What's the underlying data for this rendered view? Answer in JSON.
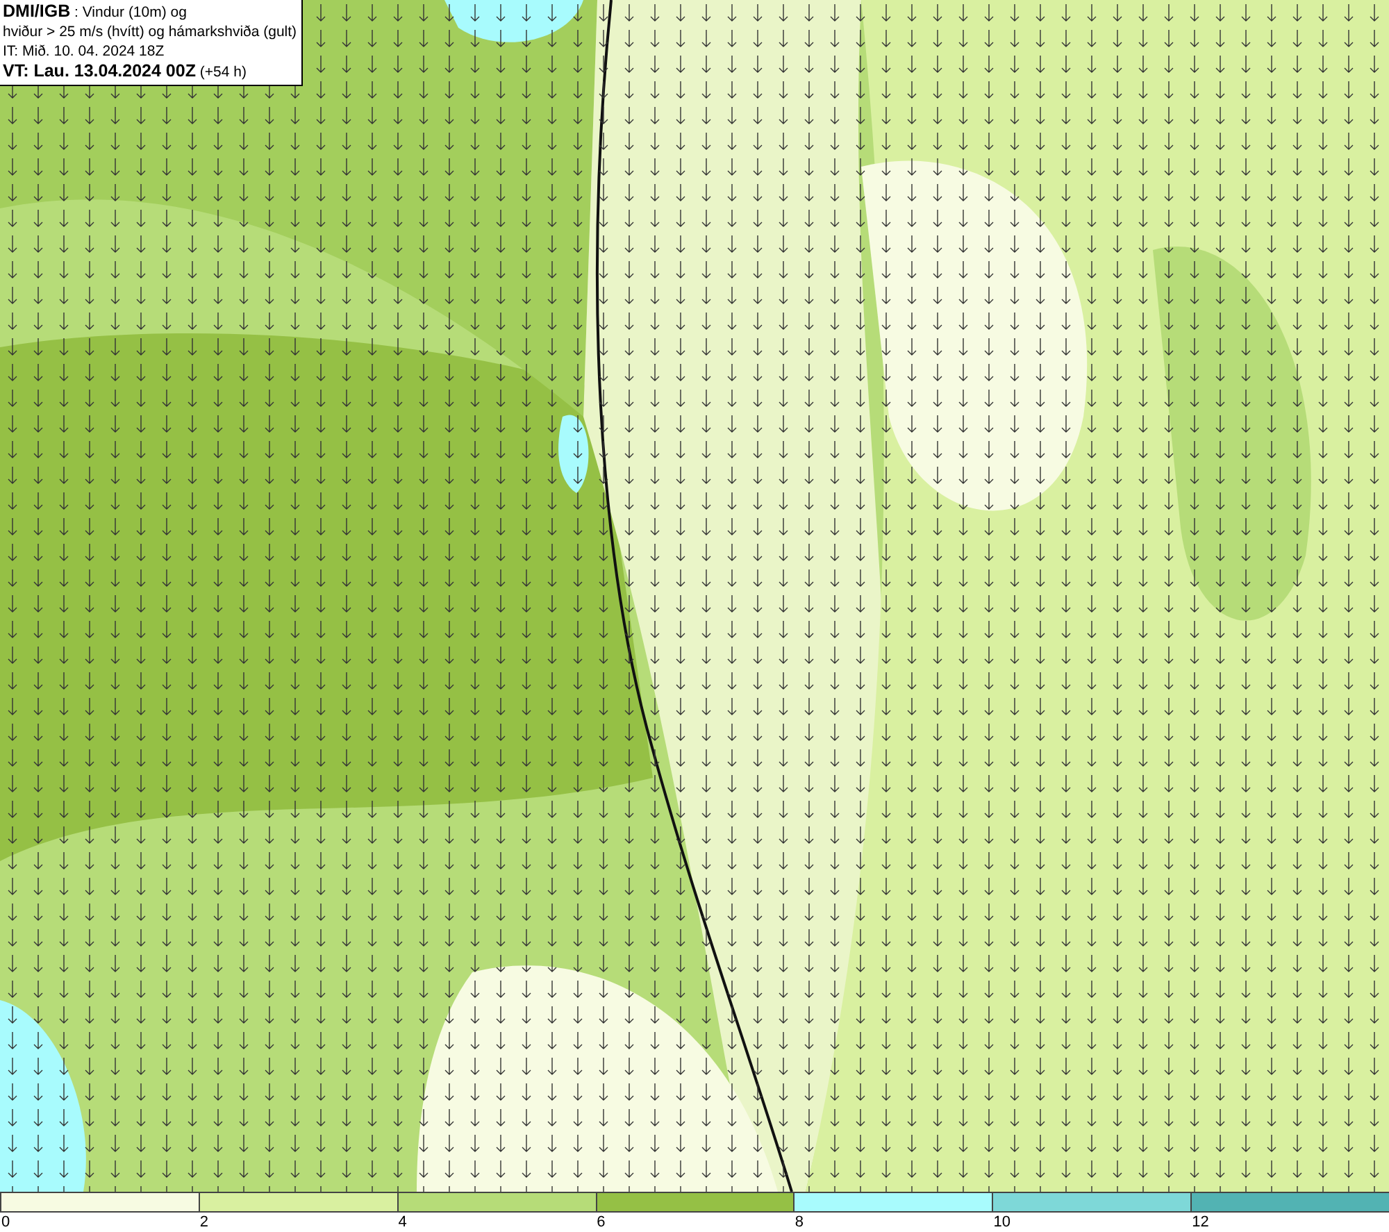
{
  "header": {
    "lines": [
      "**DMI/IGB** : Vindur (10m) og",
      "hviður > 25 m/s (hvítt) og hámarkshviða (gult)",
      "IT: Mið. 10. 04. 2024 18Z",
      "**VT: Lau. 13.04.2024 00Z** (+54 h)"
    ]
  },
  "legend": {
    "segments": [
      {
        "label": "0",
        "color": "#f7fbe2"
      },
      {
        "label": "2",
        "color": "#d9f0a0"
      },
      {
        "label": "4",
        "color": "#b6dc78"
      },
      {
        "label": "6",
        "color": "#95c045"
      },
      {
        "label": "8",
        "color": "#a8fbfd"
      },
      {
        "label": "10",
        "color": "#7ed8d8"
      },
      {
        "label": "12",
        "color": "#52b3b3"
      }
    ]
  }
}
